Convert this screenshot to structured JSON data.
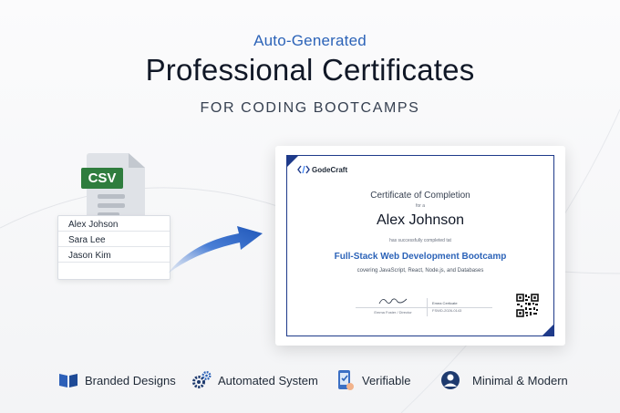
{
  "hero": {
    "kicker": "Auto-Generated",
    "headline": "Professional Certificates",
    "subhead": "FOR CODING BOOTCAMPS"
  },
  "csv_file": {
    "badge": "CSV",
    "badge_color": "#2f7d3e",
    "icon": "file-icon"
  },
  "name_list": {
    "names": [
      "Alex Johson",
      "Sara Lee",
      "Jason Kim"
    ]
  },
  "arrow": {
    "icon": "curved-arrow-icon",
    "color": "#2a62c4"
  },
  "certificate": {
    "brand": "GodeCraft",
    "brand_icon": "code-brackets-icon",
    "title": "Certificate of Completion",
    "for_text": "for a",
    "recipient": "Alex Johnson",
    "completed_text": "has successfully completed tat",
    "course": "Full-Stack Web Development Bootcamp",
    "covering": "covering JavaScript, React, Node.js, and Databases",
    "signer": "Emma Foster / Director",
    "cert_label": "Emea Certicate",
    "cert_id": "FSWD-2026-0143",
    "qr_icon": "qr-code-icon",
    "frame_color": "#1e3a8a"
  },
  "features": [
    {
      "icon": "book-icon",
      "label": "Branded Designs"
    },
    {
      "icon": "gears-icon",
      "label": "Automated System"
    },
    {
      "icon": "phone-check-icon",
      "label": "Verifiable"
    },
    {
      "icon": "person-globe-icon",
      "label": "Minimal & Modern"
    }
  ],
  "colors": {
    "accent": "#2c63b8",
    "heading": "#111827"
  }
}
